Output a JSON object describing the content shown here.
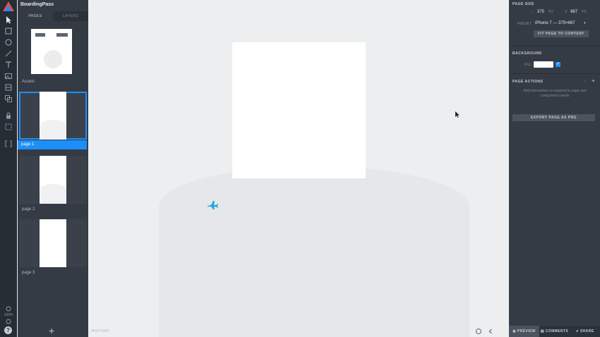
{
  "app": {
    "title": "BoardingPass"
  },
  "pages_panel": {
    "tabs": [
      {
        "label": "PAGES"
      },
      {
        "label": "LAYERS"
      }
    ],
    "items": [
      {
        "label": "Assets"
      },
      {
        "label": "page 1"
      },
      {
        "label": "page 2"
      },
      {
        "label": "page 3"
      }
    ],
    "add_icon": "plus-icon"
  },
  "tools": [
    "pointer-icon",
    "rectangle-icon",
    "ellipse-icon",
    "pen-icon",
    "text-icon",
    "image-icon",
    "component-icon",
    "layers-icon",
    "lock-icon",
    "frame-icon",
    "code-icon"
  ],
  "rail": {
    "zoom_label": "100%"
  },
  "canvas": {
    "history_label": "HISTORY"
  },
  "inspector": {
    "page_size": {
      "title": "PAGE SIZE",
      "width": "375",
      "width_unit": "PX",
      "height": "667",
      "height_unit": "PX",
      "preset_label": "PRESET",
      "preset_value": "iPhone 7  —  375×667",
      "fit_button": "FIT PAGE TO CONTENT"
    },
    "background": {
      "title": "BACKGROUND",
      "fill_label": "FILL",
      "fill_color": "#ffffff"
    },
    "page_actions": {
      "title": "PAGE ACTIONS",
      "hint": "Add interactions to respond to page and component events"
    },
    "export_button": "EXPORT PAGE AS PNG",
    "bottom": [
      {
        "label": "PREVIEW"
      },
      {
        "label": "COMMENTS"
      },
      {
        "label": "SHARE"
      }
    ]
  },
  "colors": {
    "accent": "#1e8ff7",
    "plane": "#1fa3e0",
    "panel": "#343b45",
    "canvas": "#eceef0"
  }
}
